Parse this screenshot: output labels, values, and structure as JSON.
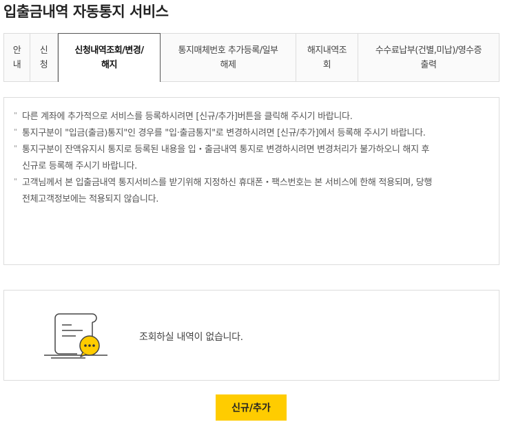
{
  "page": {
    "title": "입출금내역 자동통지 서비스"
  },
  "tabs": [
    {
      "label": "안\n내",
      "active": false
    },
    {
      "label": "신\n청",
      "active": false
    },
    {
      "label": "신청내역조회/변경/\n해지",
      "active": true
    },
    {
      "label": "통지매체번호 추가등록/일부\n해제",
      "active": false
    },
    {
      "label": "해지내역조\n회",
      "active": false
    },
    {
      "label": "수수료납부(건별,미납)/영수증\n출력",
      "active": false
    }
  ],
  "notices": [
    "다른 계좌에 추가적으로 서비스를 등록하시려면 [신규/추가]버튼을 클릭해 주시기 바랍니다.",
    "통지구분이 \"입금(출금)통지\"인 경우를 \"입·출금통지\"로 변경하시려면 [신규/추가]에서 등록해 주시기 바랍니다.",
    "통지구분이 잔액유지시 통지로 등록된 내용을 입・출금내역 통지로 변경하시려면 변경처리가 불가하오니 해지 후\n신규로 등록해 주시기 바랍니다.",
    "고객님께서 본 입출금내역 통지서비스를 받기위해 지정하신 휴대폰・팩스번호는 본 서비스에 한해 적용되며, 당행\n전체고객정보에는 적용되지 않습니다."
  ],
  "empty_state": {
    "icon": "document-chat-icon",
    "message": "조회하실 내역이 없습니다."
  },
  "actions": {
    "new_label": "신규/추가"
  },
  "colors": {
    "accent": "#ffcc00",
    "border": "#dcdcdc",
    "active_tab_border": "#555555"
  }
}
